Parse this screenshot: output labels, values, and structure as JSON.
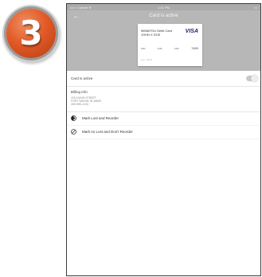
{
  "step_badge": {
    "number": "3"
  },
  "status_bar": {
    "carrier": "•••○○ Carrier ≋",
    "time": "1:41 PM",
    "battery": "▭"
  },
  "header": {
    "title": "Card is active",
    "back_icon": "arrow-left-icon"
  },
  "card": {
    "name_line1": "MIMAFOU Debit Card",
    "name_line2": "JOHN X DOE",
    "brand": "VISA",
    "number_groups": [
      "••••",
      "••••",
      "••••",
      "7889"
    ],
    "expiry": "Exp. 09/25"
  },
  "card_active_row": {
    "label": "Card is active",
    "toggle_on": true
  },
  "billing": {
    "title": "Billing Info",
    "address_line1": "4114 MAIN STREET",
    "address_line2": "FORT WAYNE IN 46805",
    "phone": "260-555-1234"
  },
  "actions": [
    {
      "label": "Mark Lost and Reorder",
      "icon": "reorder-toggle-icon"
    },
    {
      "label": "Mark As Lost and Don't Reorder",
      "icon": "block-icon"
    }
  ],
  "colors": {
    "header_bg": "#b7b7b7",
    "status_bg": "#ababab",
    "badge": "#e25a27",
    "visa": "#1a1f71"
  }
}
